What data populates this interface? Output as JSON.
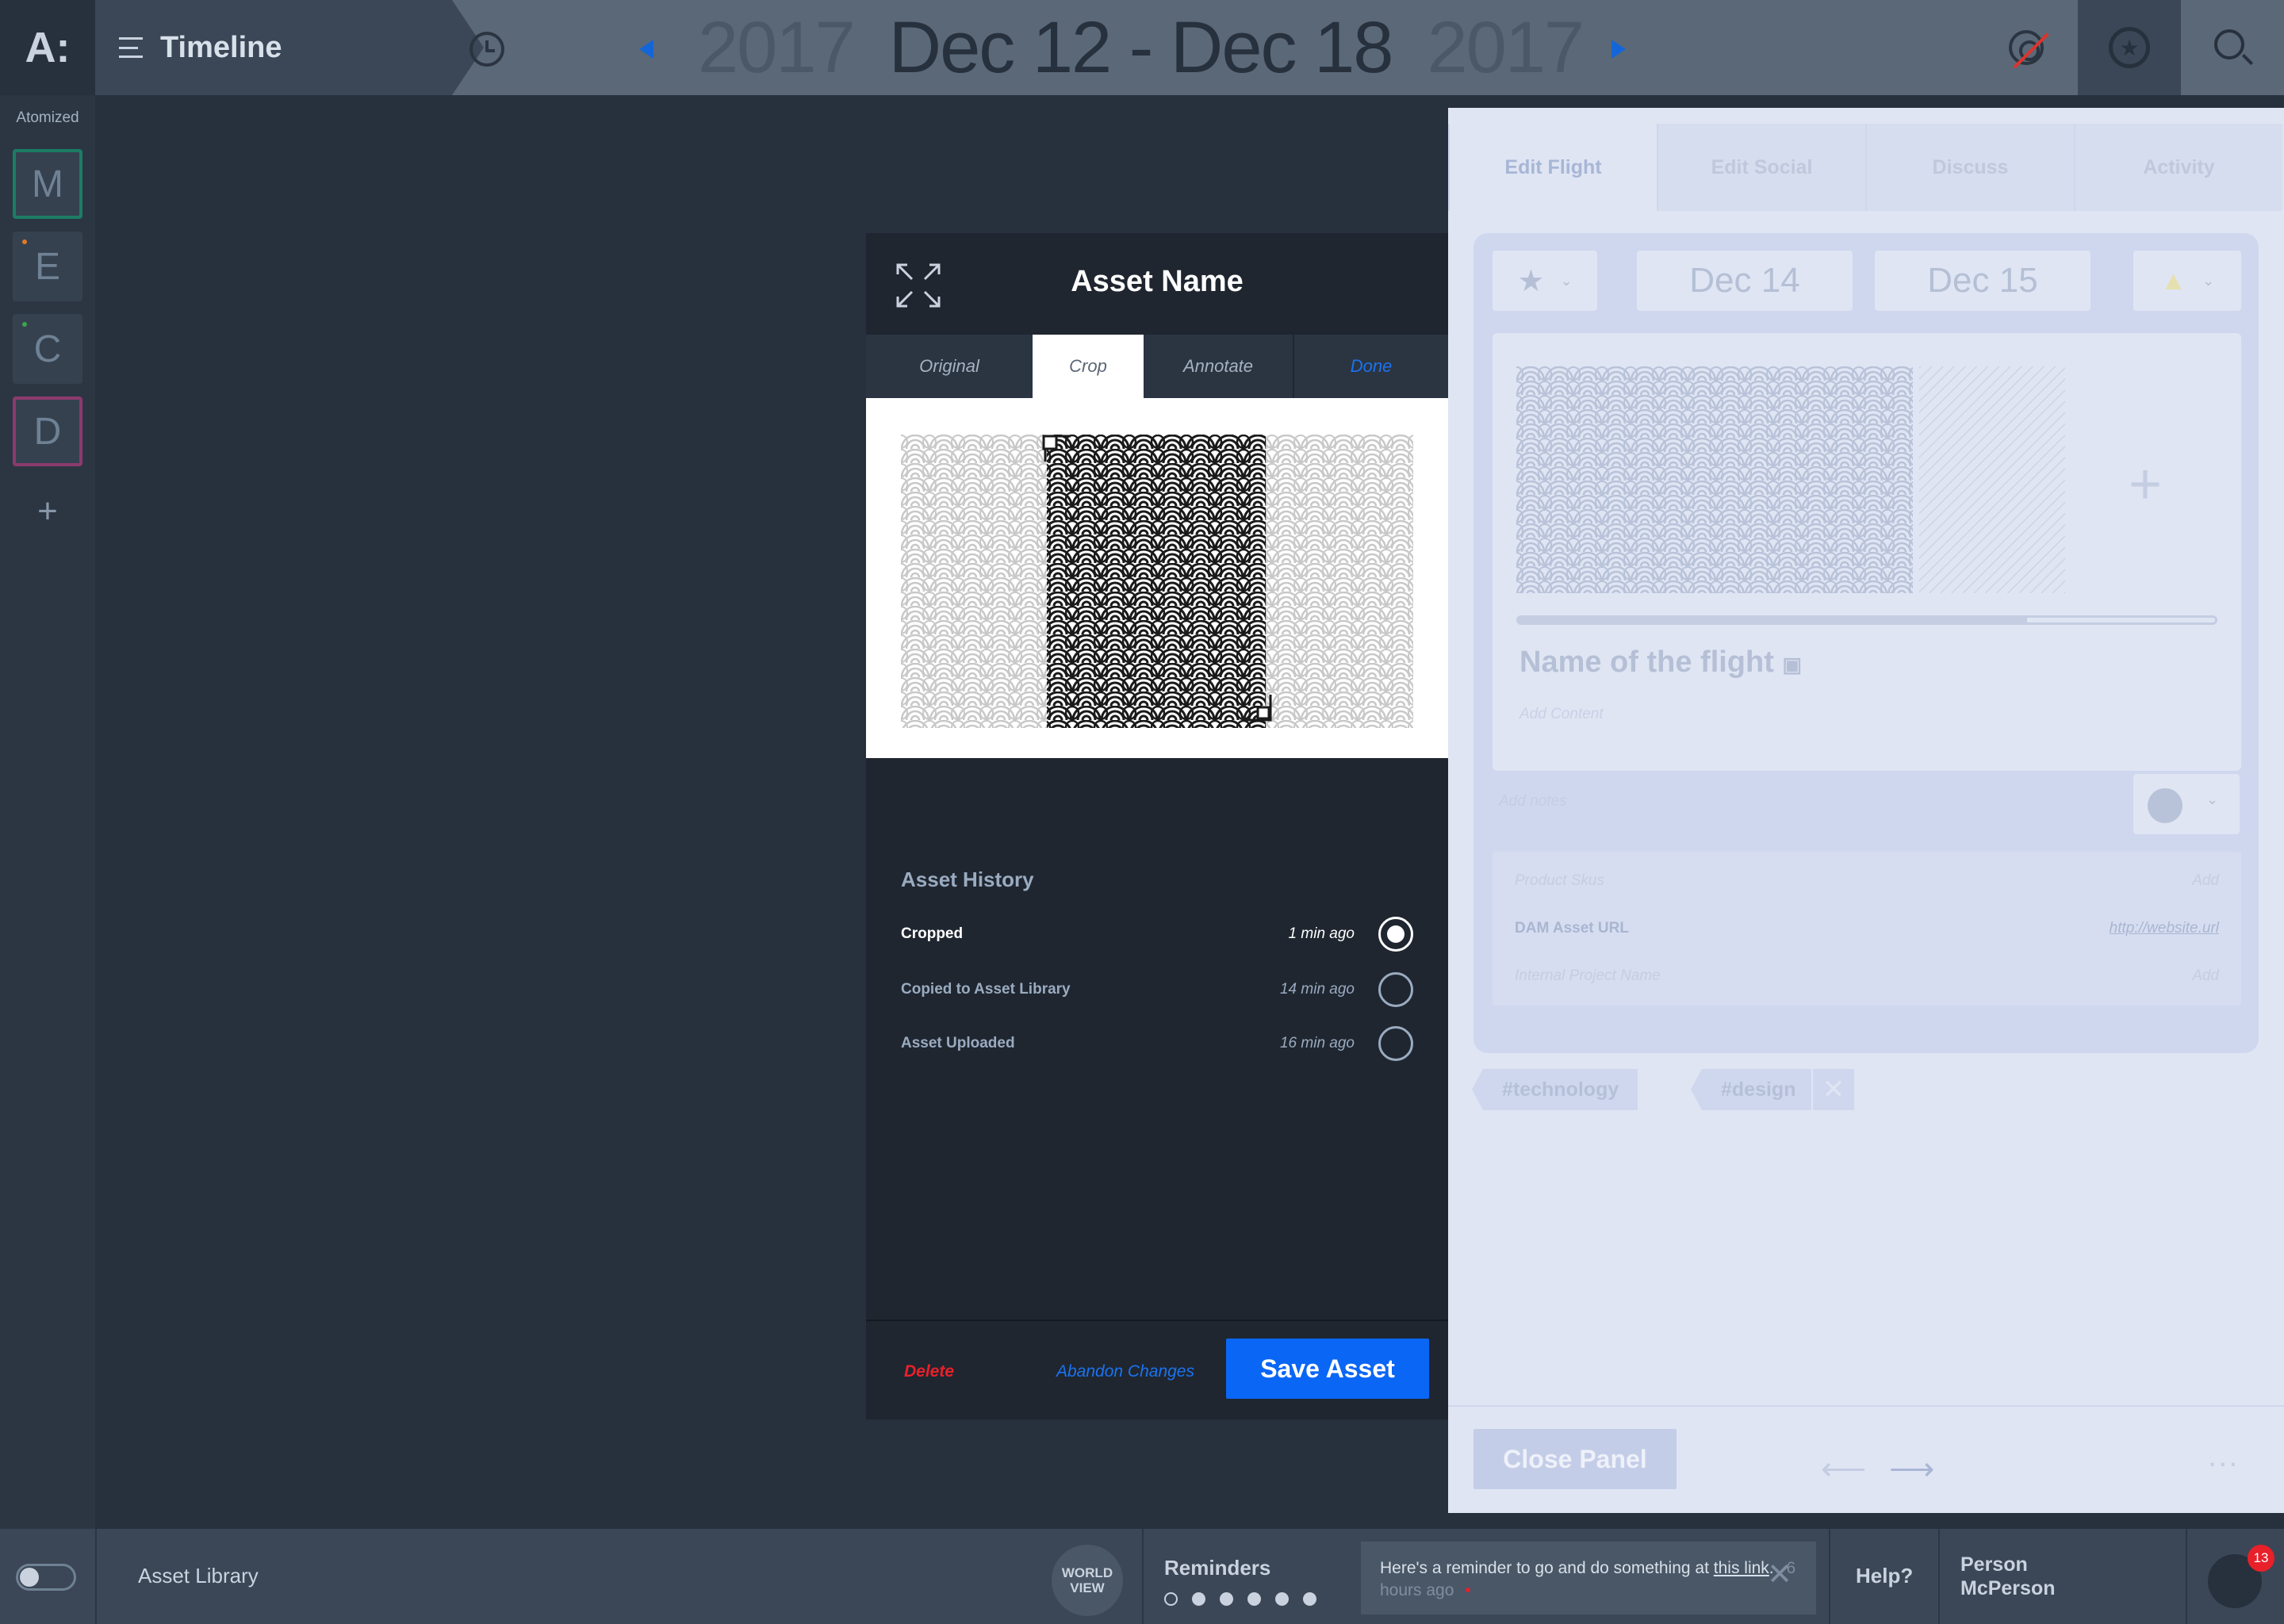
{
  "app": {
    "logo_text": "A:",
    "title": "Timeline"
  },
  "date_range": {
    "start_year": "2017",
    "range": "Dec 12 - Dec 18",
    "end_year": "2017"
  },
  "sidebar": {
    "label": "Atomized",
    "workspaces": [
      {
        "letter": "M",
        "color": "#1c7c65"
      },
      {
        "letter": "E",
        "color": "#e07a2c"
      },
      {
        "letter": "C",
        "color": "#3fa34d"
      },
      {
        "letter": "D",
        "color": "#8c3a6f"
      }
    ],
    "add_label": "+"
  },
  "modal": {
    "title": "Asset Name",
    "tabs": [
      {
        "label": "Original",
        "active": false
      },
      {
        "label": "Crop",
        "active": true
      },
      {
        "label": "Annotate",
        "active": false
      }
    ],
    "done_label": "Done",
    "history": {
      "title": "Asset History",
      "items": [
        {
          "label": "Cropped",
          "time": "1 min ago",
          "selected": true
        },
        {
          "label": "Copied to Asset Library",
          "time": "14 min ago",
          "selected": false
        },
        {
          "label": "Asset Uploaded",
          "time": "16 min ago",
          "selected": false
        }
      ]
    },
    "footer": {
      "delete_label": "Delete",
      "abandon_label": "Abandon Changes",
      "save_label": "Save Asset"
    }
  },
  "panel": {
    "tabs": [
      {
        "label": "Edit Flight",
        "active": true
      },
      {
        "label": "Edit Social",
        "active": false
      },
      {
        "label": "Discuss",
        "active": false
      },
      {
        "label": "Activity",
        "active": false
      }
    ],
    "start_date": "Dec 14",
    "end_date": "Dec 15",
    "progress": 0.73,
    "flight_name": "Name of the flight",
    "add_content": "Add Content",
    "add_notes": "Add notes",
    "fields": [
      {
        "key": "Product Skus",
        "value": "Add"
      },
      {
        "key": "DAM Asset URL",
        "value": "http://website.url"
      },
      {
        "key": "Internal Project Name",
        "value": "Add"
      }
    ],
    "tags": [
      "#technology",
      "#design"
    ],
    "close_label": "Close Panel",
    "more_label": "..."
  },
  "bottombar": {
    "asset_library": "Asset Library",
    "worldview": "WORLD VIEW",
    "reminders_title": "Reminders",
    "reminder": {
      "text": "Here's a reminder to go and do something at",
      "link": "this link",
      "suffix": ".",
      "ago": "6 hours ago",
      "marker": "•"
    },
    "help": "Help?",
    "person_first": "Person",
    "person_last": "McPerson",
    "notifications": "13"
  },
  "colors": {
    "primary": "#0a66f5",
    "danger": "#e8202a",
    "background": "#27303d"
  }
}
